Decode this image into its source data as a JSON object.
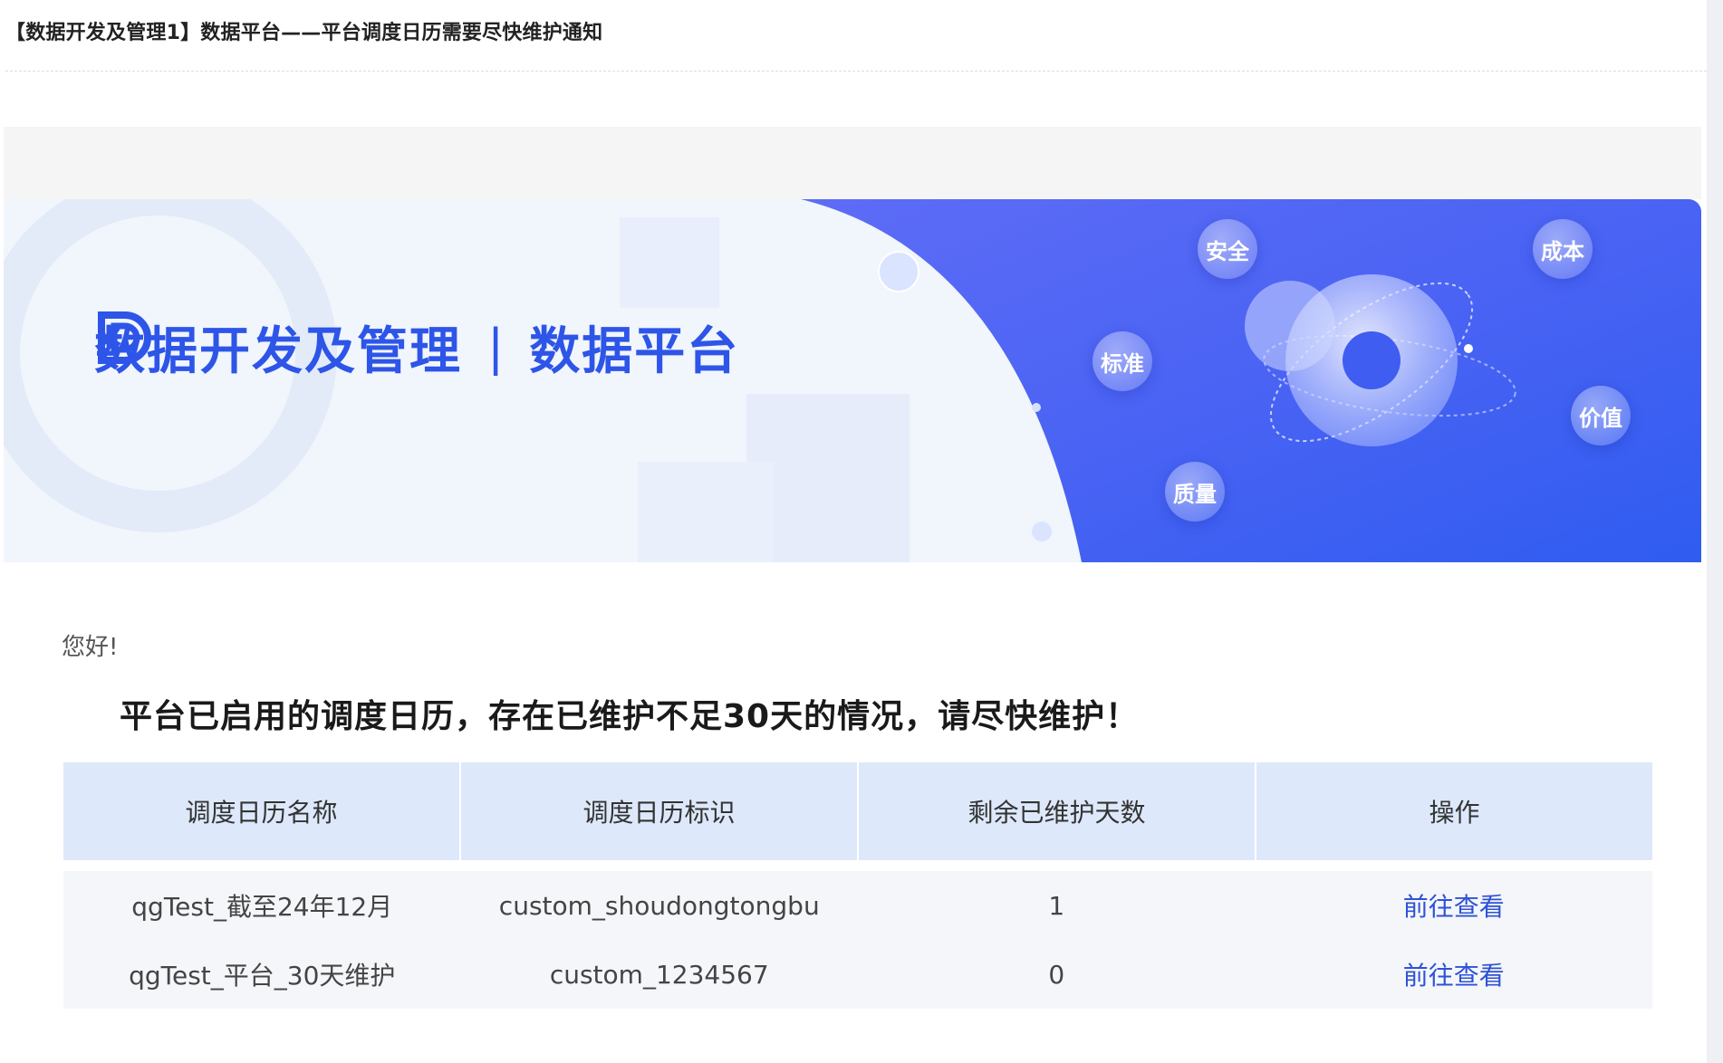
{
  "mail": {
    "subject": "【数据开发及管理1】数据平台——平台调度日历需要尽快维护通知"
  },
  "banner": {
    "brand_name": "数据开发及管理",
    "separator": "|",
    "brand_sub": "数据平台",
    "bubbles": [
      "安全",
      "成本",
      "标准",
      "价值",
      "质量"
    ]
  },
  "content": {
    "greeting": "您好!",
    "headline": "平台已启用的调度日历，存在已维护不足30天的情况，请尽快维护！"
  },
  "table": {
    "headers": [
      "调度日历名称",
      "调度日历标识",
      "剩余已维护天数",
      "操作"
    ],
    "rows": [
      {
        "name": "qgTest_截至24年12月",
        "id": "custom_shoudongtongbu",
        "days": "1",
        "action": "前往查看"
      },
      {
        "name": "qgTest_平台_30天维护",
        "id": "custom_1234567",
        "days": "0",
        "action": "前往查看"
      }
    ]
  },
  "colors": {
    "accent": "#2d55e8",
    "banner_blue": "#3b5cf0",
    "table_header_bg": "#dde9fb",
    "table_body_bg": "#f4f6f9",
    "link": "#2e52d6"
  }
}
